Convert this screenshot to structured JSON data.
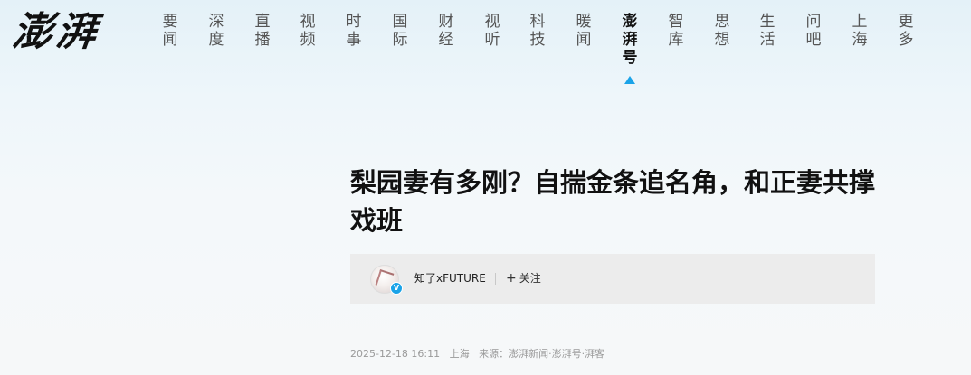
{
  "site": {
    "logo_text": "澎湃"
  },
  "nav": {
    "items": [
      {
        "label": "要\n闻"
      },
      {
        "label": "深\n度"
      },
      {
        "label": "直\n播"
      },
      {
        "label": "视\n频"
      },
      {
        "label": "时\n事"
      },
      {
        "label": "国\n际"
      },
      {
        "label": "财\n经"
      },
      {
        "label": "视\n听"
      },
      {
        "label": "科\n技"
      },
      {
        "label": "暖\n闻"
      },
      {
        "label": "澎\n湃\n号",
        "active": true
      },
      {
        "label": "智\n库"
      },
      {
        "label": "思\n想"
      },
      {
        "label": "生\n活"
      },
      {
        "label": "问\n吧"
      },
      {
        "label": "上\n海"
      },
      {
        "label": "更\n多"
      }
    ],
    "active_color": "#1aa3e8"
  },
  "article": {
    "title": "梨园妻有多刚？自揣金条追名角，和正妻共撑戏班",
    "author": {
      "name": "知了xFUTURE",
      "verified_mark": "V",
      "follow_label": "关注",
      "follow_icon": "plus-icon"
    },
    "meta": {
      "datetime": "2025-12-18 16:11",
      "location": "上海",
      "source": "来源：澎湃新闻·澎湃号·湃客"
    }
  }
}
